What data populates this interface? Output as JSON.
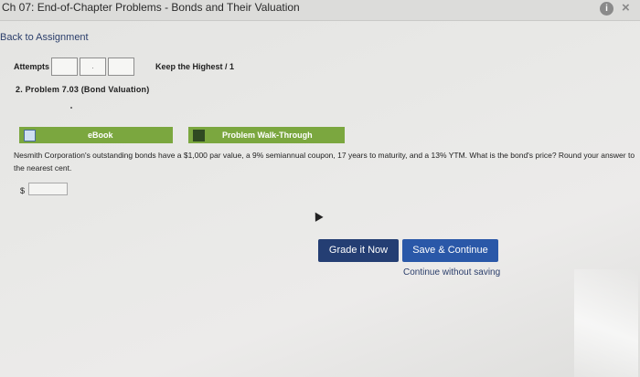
{
  "window": {
    "title": "Ch 07: End-of-Chapter Problems - Bonds and Their Valuation",
    "info_icon": "info-icon",
    "info_glyph": "i",
    "close_icon": "close-icon",
    "close_glyph": "×"
  },
  "nav": {
    "back_label": "Back to Assignment"
  },
  "attempts": {
    "label": "Attempts",
    "boxes": [
      "",
      ".",
      ""
    ],
    "keep_label": "Keep the Highest / 1"
  },
  "problem": {
    "title": "2. Problem 7.03 (Bond Valuation)",
    "tabs": [
      {
        "label": "eBook",
        "icon": "book-icon"
      },
      {
        "label": "Problem Walk-Through",
        "icon": "film-icon"
      }
    ],
    "question": "Nesmith Corporation's outstanding bonds have a $1,000 par value, a 9% semiannual coupon, 17 years to maturity, and a 13% YTM. What is the bond's price? Round your answer to the nearest cent.",
    "currency_symbol": "$",
    "answer_value": ""
  },
  "actions": {
    "grade_label": "Grade it Now",
    "save_label": "Save & Continue",
    "continue_label": "Continue without saving"
  },
  "colors": {
    "tab_green": "#7ba73f",
    "grade_button": "#243e73",
    "save_button": "#2a58a8",
    "link": "#2b3e6b"
  }
}
